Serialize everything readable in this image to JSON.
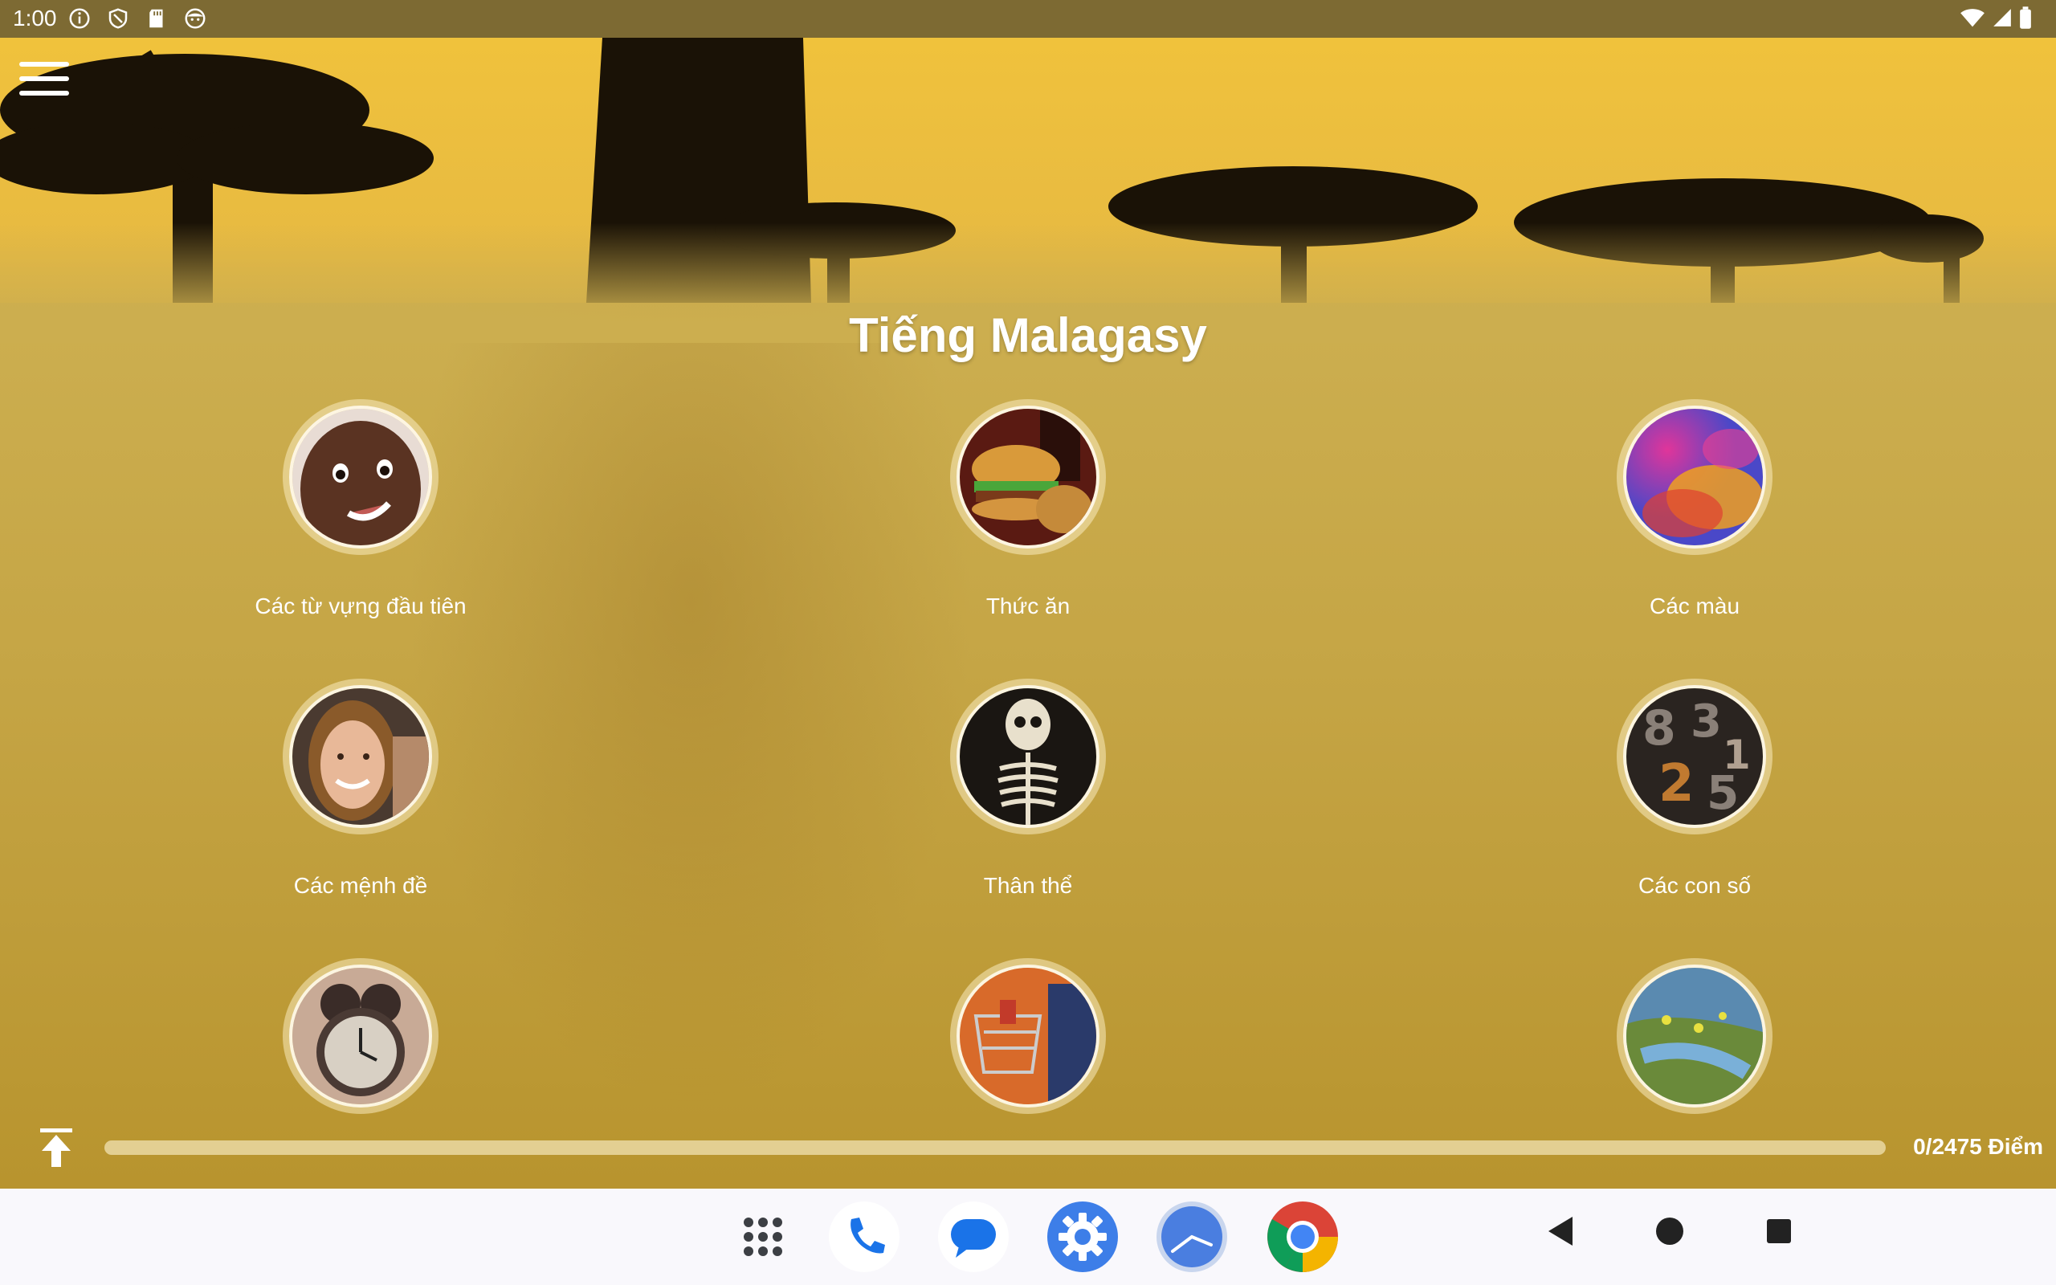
{
  "status_bar": {
    "time": "1:00",
    "left_icons": [
      "info-icon",
      "shield-icon",
      "sd-card-icon",
      "face-icon"
    ],
    "right_icons": [
      "wifi-icon",
      "signal-icon",
      "battery-icon"
    ]
  },
  "app": {
    "title": "Tiếng Malagasy",
    "menu_icon": "hamburger-menu-icon",
    "categories": [
      {
        "label": "Các từ vựng đầu tiên",
        "image": "child-face"
      },
      {
        "label": "Thức ăn",
        "image": "burger-meal"
      },
      {
        "label": "Các màu",
        "image": "color-smoke"
      },
      {
        "label": "Các mệnh đề",
        "image": "smiling-woman"
      },
      {
        "label": "Thân thể",
        "image": "skeleton"
      },
      {
        "label": "Các con số",
        "image": "metal-numbers"
      },
      {
        "label": "",
        "image": "alarm-clock"
      },
      {
        "label": "",
        "image": "shopping-cart"
      },
      {
        "label": "",
        "image": "river-landscape"
      }
    ]
  },
  "progress": {
    "points": 0,
    "total": 2475,
    "text": "0/2475 Điểm",
    "fraction": 0
  },
  "nav_bar": {
    "dock": [
      "app-drawer-icon",
      "phone-icon",
      "messages-icon",
      "settings-icon",
      "clock-icon",
      "chrome-icon"
    ],
    "keys": [
      "back-icon",
      "home-icon",
      "recents-icon"
    ]
  },
  "colors": {
    "status_bar": "#7d6a33",
    "app_gold": "#c9a93c",
    "nav_bar": "#f9f8fc"
  }
}
